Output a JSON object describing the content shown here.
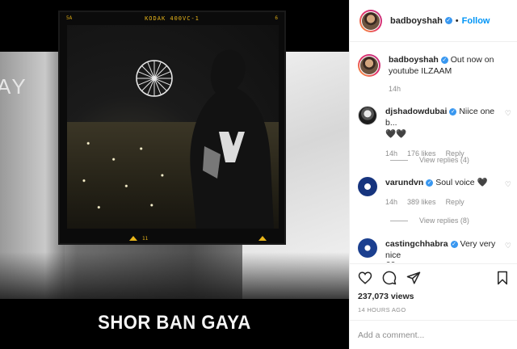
{
  "post": {
    "username": "badboyshah",
    "follow_label": "Follow",
    "separator": "•",
    "caption_text": "Out now on youtube ILZAAM",
    "caption_time": "14h",
    "views": "237,073 views",
    "timestamp": "14 HOURS AGO",
    "comment_placeholder": "Add a comment..."
  },
  "video": {
    "film_brand": "KODAK 400VC-1",
    "film_num_left": "5A",
    "film_num_right": "6",
    "frame_counter": "11",
    "bg_text": "AY",
    "subtitle": "SHOR BAN GAYA"
  },
  "comments": [
    {
      "username": "djshadowdubai",
      "text": "Niice one b...",
      "emoji": "🖤🖤",
      "time": "14h",
      "likes": "176 likes",
      "reply": "Reply",
      "view_replies": "View replies (4)"
    },
    {
      "username": "varundvn",
      "text": "Soul voice 🖤",
      "time": "14h",
      "likes": "389 likes",
      "reply": "Reply",
      "view_replies": "View replies (8)"
    },
    {
      "username": "castingchhabra",
      "text": "Very very nice",
      "emoji": "🖤"
    }
  ],
  "icons": {
    "verified": "verified-badge-icon",
    "like": "heart-icon",
    "comment": "comment-icon",
    "share": "paper-plane-icon",
    "save": "bookmark-icon",
    "more": "ellipsis-icon"
  },
  "colors": {
    "link_blue": "#0095f6",
    "verified_blue": "#3897f0",
    "meta_gray": "#8e8e8e",
    "text_dark": "#262626",
    "film_orange": "#e8b51a"
  }
}
